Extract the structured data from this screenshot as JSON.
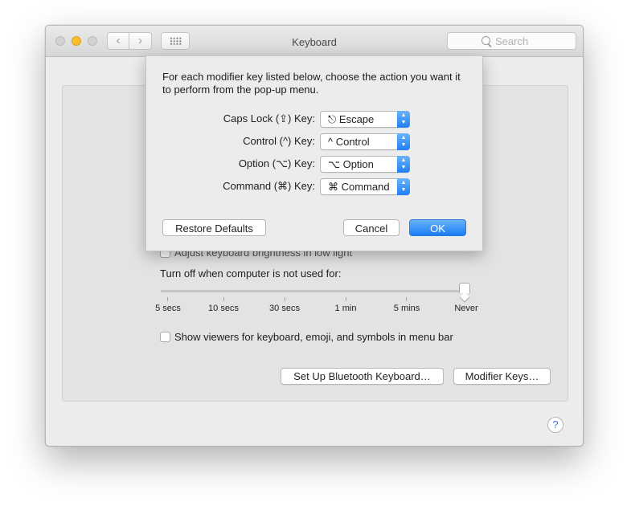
{
  "window": {
    "title": "Keyboard",
    "search_placeholder": "Search"
  },
  "panel": {
    "brightness_label": "Adjust keyboard brightness in low light",
    "turn_off_label": "Turn off when computer is not used for:",
    "slider": {
      "ticks": [
        "5 secs",
        "10 secs",
        "30 secs",
        "1 min",
        "5 mins",
        "Never"
      ],
      "selected": "Never"
    },
    "viewers_label": "Show viewers for keyboard, emoji, and symbols in menu bar",
    "bluetooth_button": "Set Up Bluetooth Keyboard…",
    "modifier_button": "Modifier Keys…",
    "help": "?"
  },
  "sheet": {
    "description": "For each modifier key listed below, choose the action you want it to perform from the pop-up menu.",
    "rows": [
      {
        "label": "Caps Lock (⇪) Key:",
        "value": "⎋ Escape"
      },
      {
        "label": "Control (^) Key:",
        "value": "^ Control"
      },
      {
        "label": "Option (⌥) Key:",
        "value": "⌥ Option"
      },
      {
        "label": "Command (⌘) Key:",
        "value": "⌘ Command"
      }
    ],
    "restore_button": "Restore Defaults",
    "cancel_button": "Cancel",
    "ok_button": "OK"
  },
  "colors": {
    "accent": "#1a7df5",
    "minimize": "#fdbd2f"
  }
}
